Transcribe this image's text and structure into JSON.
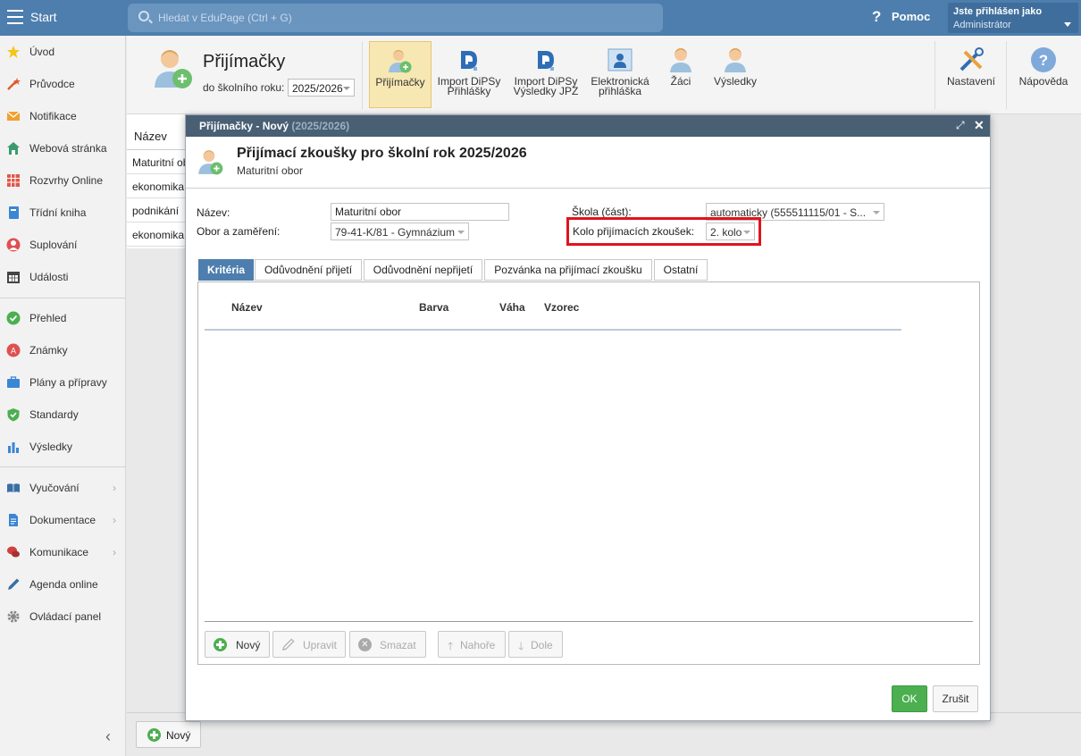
{
  "topbar": {
    "start_label": "Start",
    "search_placeholder": "Hledat v EduPage (Ctrl + G)",
    "help_icon": "?",
    "help_label": "Pomoc",
    "user_line1": "Jste přihlášen jako",
    "user_line2": "Administrátor"
  },
  "sidebar": {
    "items": [
      {
        "label": "Úvod",
        "icon": "star-icon",
        "color": "#f5c518"
      },
      {
        "label": "Průvodce",
        "icon": "wand-icon",
        "color": "#e05a2b"
      },
      {
        "label": "Notifikace",
        "icon": "envelope-icon",
        "color": "#f0a030"
      },
      {
        "label": "Webová stránka",
        "icon": "house-icon",
        "color": "#3a9a6e"
      },
      {
        "label": "Rozvrhy Online",
        "icon": "grid-icon",
        "color": "#e0584a"
      },
      {
        "label": "Třídní kniha",
        "icon": "book-icon",
        "color": "#3a86d4"
      },
      {
        "label": "Suplování",
        "icon": "person-icon",
        "color": "#e05050"
      },
      {
        "label": "Události",
        "icon": "calendar-icon",
        "color": "#444444"
      },
      {
        "label": "Přehled",
        "icon": "check-circle-icon",
        "color": "#4caf50"
      },
      {
        "label": "Známky",
        "icon": "grade-icon",
        "color": "#e05050"
      },
      {
        "label": "Plány a přípravy",
        "icon": "briefcase-icon",
        "color": "#3a86d4"
      },
      {
        "label": "Standardy",
        "icon": "shield-icon",
        "color": "#4caf50"
      },
      {
        "label": "Výsledky",
        "icon": "bar-chart-icon",
        "color": "#3a86d4"
      },
      {
        "label": "Vyučování",
        "icon": "open-book-icon",
        "color": "#3a6ea5"
      },
      {
        "label": "Dokumentace",
        "icon": "document-icon",
        "color": "#3a86d4"
      },
      {
        "label": "Komunikace",
        "icon": "chat-icon",
        "color": "#d04040"
      },
      {
        "label": "Agenda online",
        "icon": "pen-icon",
        "color": "#3a6ea5"
      },
      {
        "label": "Ovládací panel",
        "icon": "gear-icon",
        "color": "#888888"
      }
    ],
    "collapse_glyph": "‹"
  },
  "toolbar": {
    "title": "Přijímačky",
    "year_label": "do školního roku:",
    "year_value": "2025/2026",
    "buttons": [
      {
        "line1": "Přijímačky",
        "line2": ""
      },
      {
        "line1": "Import DiPSy",
        "line2": "Přihlášky"
      },
      {
        "line1": "Import DiPSy",
        "line2": "Výsledky JPZ"
      },
      {
        "line1": "Elektronická",
        "line2": "přihláška"
      },
      {
        "line1": "Žáci",
        "line2": ""
      },
      {
        "line1": "Výsledky",
        "line2": ""
      },
      {
        "line1": "Nastavení",
        "line2": ""
      },
      {
        "line1": "Nápověda",
        "line2": ""
      }
    ]
  },
  "background_list": {
    "header": "Název",
    "rows": [
      "Maturitní obor",
      "ekonomika",
      "podnikání",
      "ekonomika"
    ],
    "new_button": "Nový"
  },
  "dialog": {
    "title": "Přijímačky - Nový",
    "title_suffix": "(2025/2026)",
    "maximize_glyph": "⤢",
    "close_glyph": "✕",
    "heading": "Přijímací zkoušky pro školní rok 2025/2026",
    "subheading": "Maturitní obor",
    "form": {
      "name_label": "Název:",
      "name_value": "Maturitní obor",
      "field_label": "Obor a zaměření:",
      "field_value": "79-41-K/81 - Gymnázium",
      "school_label": "Škola (část):",
      "school_value": "automaticky (555511115/01 - S...",
      "round_label": "Kolo přijímacích zkoušek:",
      "round_value": "2. kolo"
    },
    "tabs": [
      "Kritéria",
      "Odůvodnění přijetí",
      "Odůvodnění nepřijetí",
      "Pozvánka na přijímací zkoušku",
      "Ostatní"
    ],
    "columns": [
      "Název",
      "Barva",
      "Váha",
      "Vzorec"
    ],
    "panel_buttons": {
      "new": "Nový",
      "edit": "Upravit",
      "delete": "Smazat",
      "up": "Nahoře",
      "down": "Dole"
    },
    "ok": "OK",
    "cancel": "Zrušit"
  }
}
